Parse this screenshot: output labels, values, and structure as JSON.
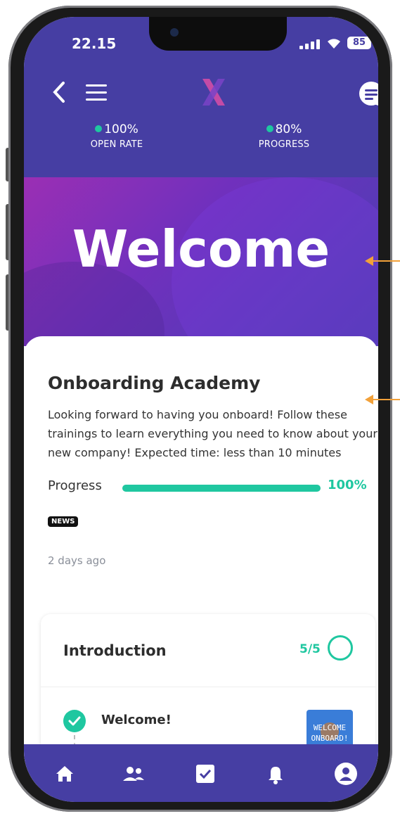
{
  "status": {
    "time": "22.15",
    "battery": "85"
  },
  "stats": [
    {
      "value": "100%",
      "label": "OPEN RATE"
    },
    {
      "value": "80%",
      "label": "PROGRESS"
    }
  ],
  "hero": {
    "title": "Welcome"
  },
  "course": {
    "title": "Onboarding Academy",
    "description": "Looking forward to having you onboard! Follow these trainings to learn everything you need to know about your new company! Expected time: less than 10 minutes",
    "progress_label": "Progress",
    "progress_value": "100%",
    "progress_fraction": 1.0,
    "tag": "NEWS",
    "posted": "2 days ago"
  },
  "module": {
    "title": "Introduction",
    "count": "5/5",
    "lessons": [
      {
        "title": "Welcome!",
        "thumb_text": "WELCOME ONBOARD!"
      }
    ]
  },
  "colors": {
    "primary": "#463ea3",
    "accent": "#1fc7a0",
    "annotation": "#f2a13a"
  },
  "tabs": [
    "home-icon",
    "people-icon",
    "checkbox-icon",
    "bell-icon",
    "profile-icon"
  ]
}
